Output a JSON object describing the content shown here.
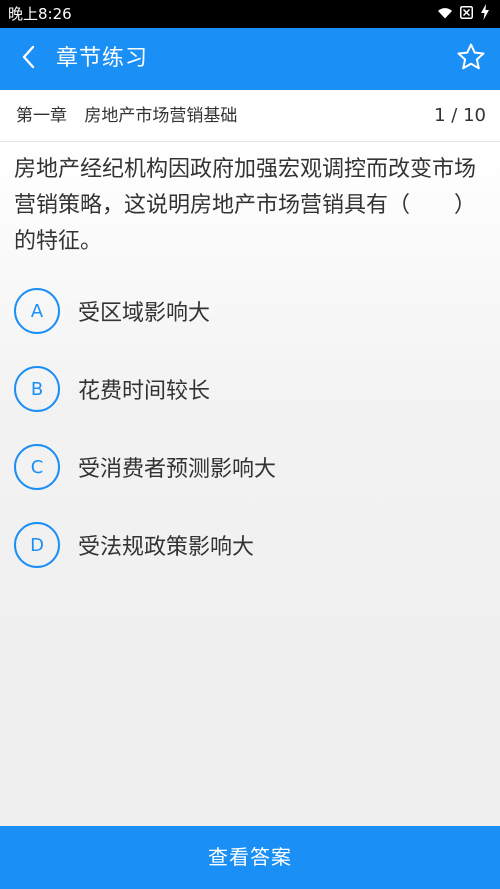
{
  "status_bar": {
    "time": "晚上8:26"
  },
  "header": {
    "title": "章节练习",
    "back_icon": "chevron-left-icon",
    "favorite_icon": "star-outline-icon"
  },
  "chapter": {
    "name": "第一章 房地产市场营销基础",
    "progress": "1 / 10"
  },
  "question": {
    "text": "房地产经纪机构因政府加强宏观调控而改变市场营销策略，这说明房地产市场营销具有（　　）的特征。",
    "options": [
      {
        "letter": "A",
        "text": "受区域影响大"
      },
      {
        "letter": "B",
        "text": "花费时间较长"
      },
      {
        "letter": "C",
        "text": "受消费者预测影响大"
      },
      {
        "letter": "D",
        "text": "受法规政策影响大"
      }
    ]
  },
  "footer": {
    "button_label": "查看答案"
  },
  "colors": {
    "primary": "#1a8ff5",
    "status_bar": "#000000",
    "text": "#333333"
  }
}
